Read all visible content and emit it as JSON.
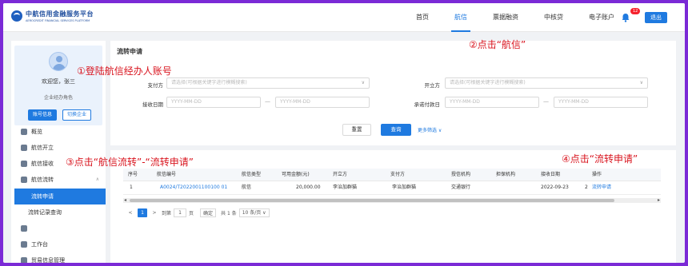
{
  "header": {
    "logo_cn": "中航信用金融服务平台",
    "logo_en": "AEROCREDIT FINANCIAL SERVICES PLATFORM",
    "nav": [
      "首页",
      "航信",
      "票据融资",
      "中核贷",
      "电子账户"
    ],
    "badge": "12",
    "logout": "退出"
  },
  "sidebar": {
    "welcome": "欢迎您，张三",
    "role": "企业经办角色",
    "account_btn": "账号信息",
    "switch_btn": "切换企业",
    "items": [
      "概览",
      "航信开立",
      "航信接收",
      "航信流转",
      "流转申请",
      "流转记录查询",
      "",
      "工作台",
      "贸易信息管理"
    ]
  },
  "main": {
    "title": "流转申请",
    "form": {
      "payer_label": "支付方",
      "payer_placeholder": "请选择(可根据关键字进行模糊搜索)",
      "issuer_label": "开立方",
      "issuer_placeholder": "请选择(可根据关键字进行模糊搜索)",
      "receive_date_label": "接收日期",
      "due_date_label": "承诺付款日",
      "date_placeholder": "YYYY-MM-DD",
      "dash": "—",
      "reset": "重置",
      "query": "查询",
      "more": "更多筛选 ∨"
    },
    "table": {
      "headers": [
        "序号",
        "航信编号",
        "航信类型",
        "可用金额(元)",
        "开立方",
        "支付方",
        "授信机构",
        "担保机构",
        "接收日期",
        "",
        "操作"
      ],
      "rows": [
        [
          "1",
          "A0024/T2022001100100 01",
          "航信",
          "20,000.00",
          "李治加群猫",
          "李治加群猫",
          "交通银行",
          "",
          "2022-09-23",
          "2",
          "流转申请"
        ]
      ]
    },
    "pager": {
      "prev": "<",
      "page": "1",
      "next": ">",
      "goto": "到第",
      "goto_value": "1",
      "unit": "页",
      "confirm": "确定",
      "total": "共 1 条",
      "size": "10 条/页 ∨"
    }
  },
  "annotations": {
    "a1": "①登陆航信经办人账号",
    "a2": "②点击“航信”",
    "a3": "③点击“航信流转”-“流转申请”",
    "a4": "④点击“流转申请”"
  }
}
